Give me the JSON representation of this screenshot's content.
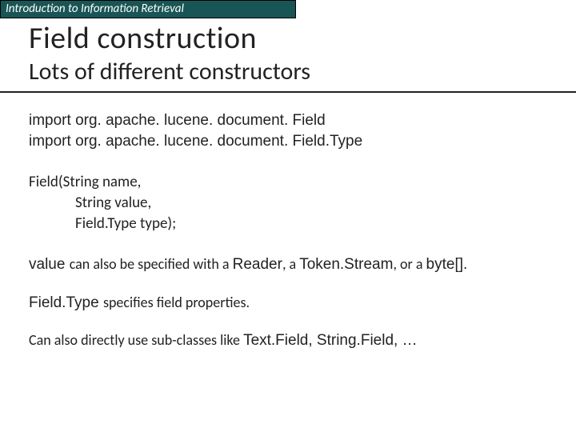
{
  "banner": "Introduction to Information Retrieval",
  "title": "Field construction",
  "subtitle": "Lots of different constructors",
  "import1": "import org. apache. lucene. document. Field",
  "import2": "import org. apache. lucene. document. Field.Type",
  "sig_line1": "Field(String name,",
  "sig_line2": "String value,",
  "sig_line3": "Field.Type type);",
  "para1_pre": "value ",
  "para1_mid1": "can also be specified with a ",
  "para1_reader": "Reader",
  "para1_mid2": ", a ",
  "para1_ts": "Token.Stream",
  "para1_mid3": ", or a ",
  "para1_ba": "byte[].",
  "para2_ft": "Field.Type ",
  "para2_rest": "specifies field properties.",
  "para3_pre": "Can also directly use sub-classes like ",
  "para3_tf": "Text.Field, String.Field, …"
}
